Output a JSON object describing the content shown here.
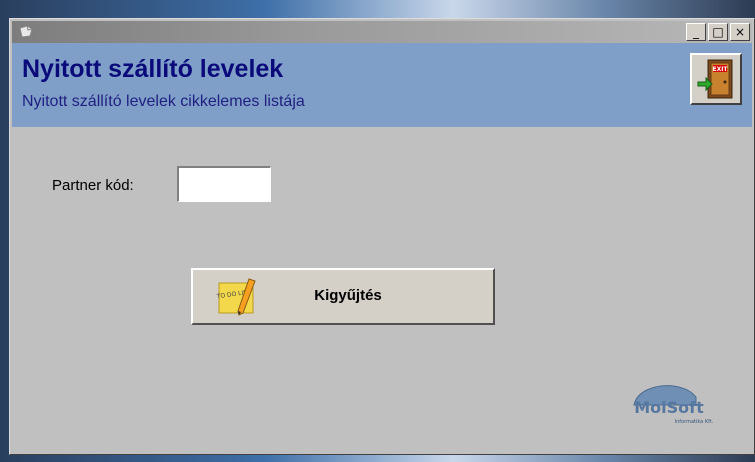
{
  "window": {
    "title": "",
    "controls": {
      "minimize": "_",
      "maximize": "□",
      "close": "×"
    }
  },
  "header": {
    "title": "Nyitott szállító levelek",
    "subtitle": "Nyitott szállító levelek cikkelemes listája",
    "exit_icon": "exit-door-icon",
    "exit_sign_text": "EXIT"
  },
  "form": {
    "partner_label": "Partner kód:",
    "partner_value": "",
    "partner_placeholder": ""
  },
  "actions": {
    "collect_label": "Kigyűjtés",
    "collect_icon": "sticky-note-pencil-icon",
    "note_text": "TO DO LIST"
  },
  "logo": {
    "brand": "MolSoft",
    "tagline": "Informatika Kft."
  },
  "colors": {
    "header_bg": "#7f9fc9",
    "title": "#0a0a7a",
    "window_bg": "#c0c0c0"
  }
}
